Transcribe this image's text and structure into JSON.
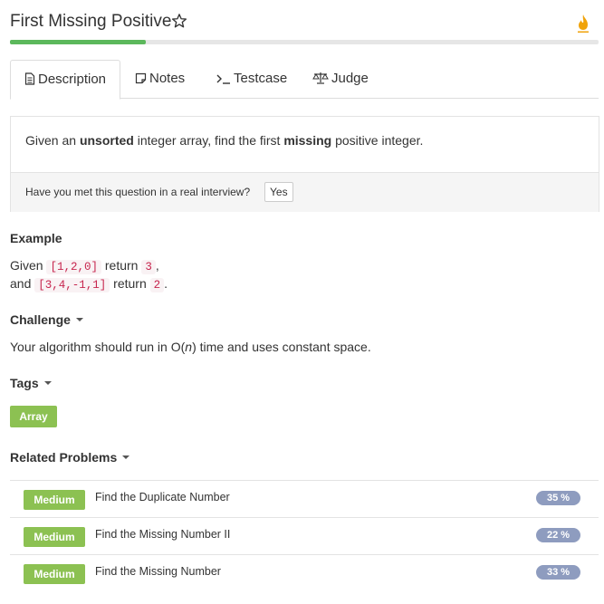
{
  "problem": {
    "title": "First Missing Positive",
    "progress": 0.23
  },
  "tabs": {
    "description": "Description",
    "notes": "Notes",
    "testcase": "Testcase",
    "judge": "Judge"
  },
  "description": {
    "p1": "Given an ",
    "b1": "unsorted",
    "p2": " integer array, find the first ",
    "b2": "missing",
    "p3": " positive integer.",
    "interview_question": "Have you met this question in a real interview?",
    "yes_label": "Yes"
  },
  "example": {
    "heading": "Example",
    "line1": {
      "prefix": "Given ",
      "input": "[1,2,0]",
      "mid": " return ",
      "output": "3",
      "suffix": ","
    },
    "line2": {
      "prefix": "and ",
      "input": "[3,4,-1,1]",
      "mid": " return ",
      "output": "2",
      "suffix": "."
    }
  },
  "challenge": {
    "heading": "Challenge",
    "text_a": "Your algorithm should run in O(",
    "text_n": "n",
    "text_b": ") time and uses constant space."
  },
  "tags": {
    "heading": "Tags",
    "items": [
      "Array"
    ]
  },
  "related": {
    "heading": "Related Problems",
    "items": [
      {
        "difficulty": "Medium",
        "title": "Find the Duplicate Number",
        "percent": "35 %"
      },
      {
        "difficulty": "Medium",
        "title": "Find the Missing Number II",
        "percent": "22 %"
      },
      {
        "difficulty": "Medium",
        "title": "Find the Missing Number",
        "percent": "33 %"
      }
    ]
  },
  "icons": {
    "favorite": "star-outline-icon",
    "streak": "fire-icon"
  },
  "colors": {
    "accent_green": "#5cb85c",
    "tag_green": "#8cc152",
    "percent_badge": "#8e9cbf",
    "code_red": "#c7254e"
  }
}
